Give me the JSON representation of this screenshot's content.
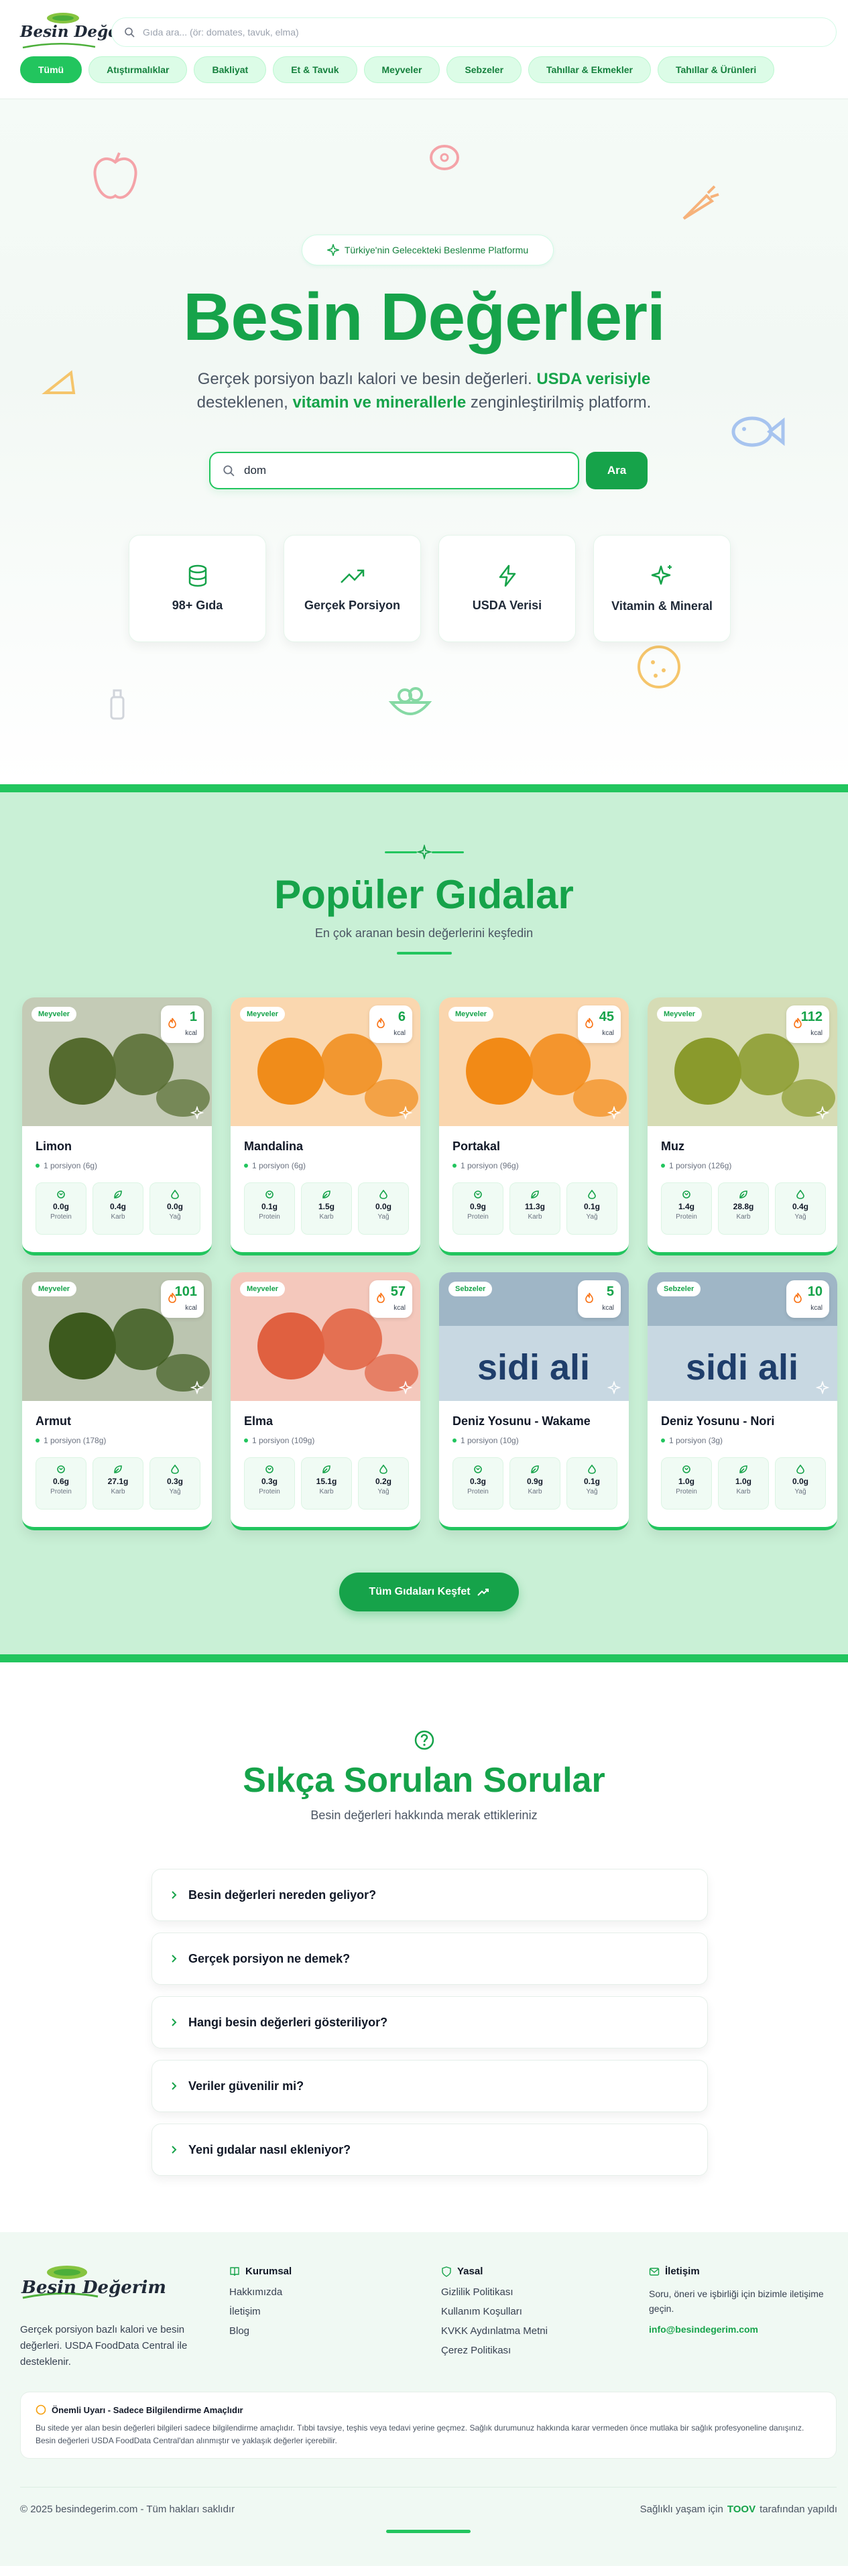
{
  "header": {
    "logo_text": "Besin Değerim",
    "search_placeholder": "Gıda ara... (ör: domates, tavuk, elma)",
    "categories": [
      "Tümü",
      "Atıştırmalıklar",
      "Bakliyat",
      "Et & Tavuk",
      "Meyveler",
      "Sebzeler",
      "Tahıllar & Ekmekler",
      "Tahıllar & Ürünleri"
    ]
  },
  "hero": {
    "pill": "Türkiye'nin Gelecekteki Beslenme Platformu",
    "title": "Besin Değerleri",
    "sub_1": "Gerçek porsiyon bazlı kalori ve besin değerleri. ",
    "sub_2": "USDA verisiyle",
    "sub_3": " desteklenen, ",
    "sub_4": "vitamin ve minerallerle",
    "sub_5": " zenginleştirilmiş platform.",
    "search_value": "dom",
    "search_button": "Ara",
    "features": [
      "98+ Gıda",
      "Gerçek Porsiyon",
      "USDA Verisi",
      "Vitamin & Mineral"
    ]
  },
  "popular": {
    "title": "Popüler Gıdalar",
    "subtitle": "En çok aranan besin değerlerini keşfedin",
    "nutrient_labels": [
      "Protein",
      "Karb",
      "Yağ"
    ],
    "kcal_unit": "kcal",
    "foods": [
      {
        "category": "Meyveler",
        "name": "Limon",
        "portion": "1 porsiyon (6g)",
        "kcal": "1",
        "protein": "0.0g",
        "carb": "0.4g",
        "fat": "0.0g",
        "color": "#556b2f"
      },
      {
        "category": "Meyveler",
        "name": "Mandalina",
        "portion": "1 porsiyon (6g)",
        "kcal": "6",
        "protein": "0.1g",
        "carb": "1.5g",
        "fat": "0.0g",
        "color": "#f08c1a"
      },
      {
        "category": "Meyveler",
        "name": "Portakal",
        "portion": "1 porsiyon (96g)",
        "kcal": "45",
        "protein": "0.9g",
        "carb": "11.3g",
        "fat": "0.1g",
        "color": "#f28a16"
      },
      {
        "category": "Meyveler",
        "name": "Muz",
        "portion": "1 porsiyon (126g)",
        "kcal": "112",
        "protein": "1.4g",
        "carb": "28.8g",
        "fat": "0.4g",
        "color": "#8a9a2c"
      },
      {
        "category": "Meyveler",
        "name": "Armut",
        "portion": "1 porsiyon (178g)",
        "kcal": "101",
        "protein": "0.6g",
        "carb": "27.1g",
        "fat": "0.3g",
        "color": "#3d5a1e"
      },
      {
        "category": "Meyveler",
        "name": "Elma",
        "portion": "1 porsiyon (109g)",
        "kcal": "57",
        "protein": "0.3g",
        "carb": "15.1g",
        "fat": "0.2g",
        "color": "#e06040"
      },
      {
        "category": "Sebzeler",
        "name": "Deniz Yosunu - Wakame",
        "portion": "1 porsiyon (10g)",
        "kcal": "5",
        "protein": "0.3g",
        "carb": "0.9g",
        "fat": "0.1g",
        "color": "#8fa8b8",
        "print": "sidi ali"
      },
      {
        "category": "Sebzeler",
        "name": "Deniz Yosunu - Nori",
        "portion": "1 porsiyon (3g)",
        "kcal": "10",
        "protein": "1.0g",
        "carb": "1.0g",
        "fat": "0.0g",
        "color": "#8fa8b8",
        "print": "sidi ali"
      }
    ],
    "explore_button": "Tüm Gıdaları Keşfet"
  },
  "faq": {
    "title": "Sıkça Sorulan Sorular",
    "subtitle": "Besin değerleri hakkında merak ettikleriniz",
    "questions": [
      "Besin değerleri nereden geliyor?",
      "Gerçek porsiyon ne demek?",
      "Hangi besin değerleri gösteriliyor?",
      "Veriler güvenilir mi?",
      "Yeni gıdalar nasıl ekleniyor?"
    ]
  },
  "footer": {
    "about": "Gerçek porsiyon bazlı kalori ve besin değerleri. USDA FoodData Central ile desteklenir.",
    "corporate_title": "Kurumsal",
    "corporate": [
      "Hakkımızda",
      "İletişim",
      "Blog"
    ],
    "legal_title": "Yasal",
    "legal": [
      "Gizlilik Politikası",
      "Kullanım Koşulları",
      "KVKK Aydınlatma Metni",
      "Çerez Politikası"
    ],
    "contact_title": "İletişim",
    "contact_text": "Soru, öneri ve işbirliği için bizimle iletişime geçin.",
    "email": "info@besindegerim.com",
    "warning_title": "Önemli Uyarı - Sadece Bilgilendirme Amaçlıdır",
    "warning_text": "Bu sitede yer alan besin değerleri bilgileri sadece bilgilendirme amaçlıdır. Tıbbi tavsiye, teşhis veya tedavi yerine geçmez. Sağlık durumunuz hakkında karar vermeden önce mutlaka bir sağlık profesyoneline danışınız. Besin değerleri USDA FoodData Central'dan alınmıştır ve yaklaşık değerler içerebilir.",
    "copyright": "© 2025 besindegerim.com - Tüm hakları saklıdır",
    "made_1": "Sağlıklı yaşam için",
    "made_brand": "TOOV",
    "made_2": "tarafından yapıldı"
  },
  "colors": {
    "brand": "#16a34a",
    "accent": "#22c55e",
    "popular_bg": "#c9f0d6"
  }
}
